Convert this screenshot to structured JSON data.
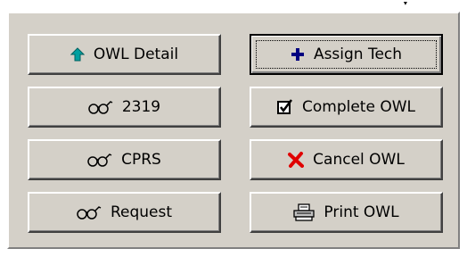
{
  "top_glyph": "ːˑ",
  "buttons": {
    "owl_detail": {
      "label": "OWL Detail",
      "icon": "arrow-up-icon",
      "icon_color": "#00a0a0"
    },
    "assign_tech": {
      "label": "Assign Tech",
      "icon": "plus-icon",
      "icon_color": "#000080"
    },
    "view_2319": {
      "label": "2319",
      "icon": "glasses-icon",
      "icon_text": "6б'"
    },
    "complete_owl": {
      "label": "Complete OWL",
      "icon": "checkbox-icon"
    },
    "cprs": {
      "label": "CPRS",
      "icon": "glasses-icon",
      "icon_text": "6б'"
    },
    "cancel_owl": {
      "label": "Cancel OWL",
      "icon": "x-icon",
      "icon_color": "#e00000"
    },
    "request": {
      "label": "Request",
      "icon": "glasses-icon",
      "icon_text": "6б'"
    },
    "print_owl": {
      "label": "Print OWL",
      "icon": "printer-icon"
    }
  },
  "colors": {
    "face": "#d4d0c8",
    "highlight": "#ffffff",
    "shadow": "#808080",
    "dark_shadow": "#404040"
  }
}
